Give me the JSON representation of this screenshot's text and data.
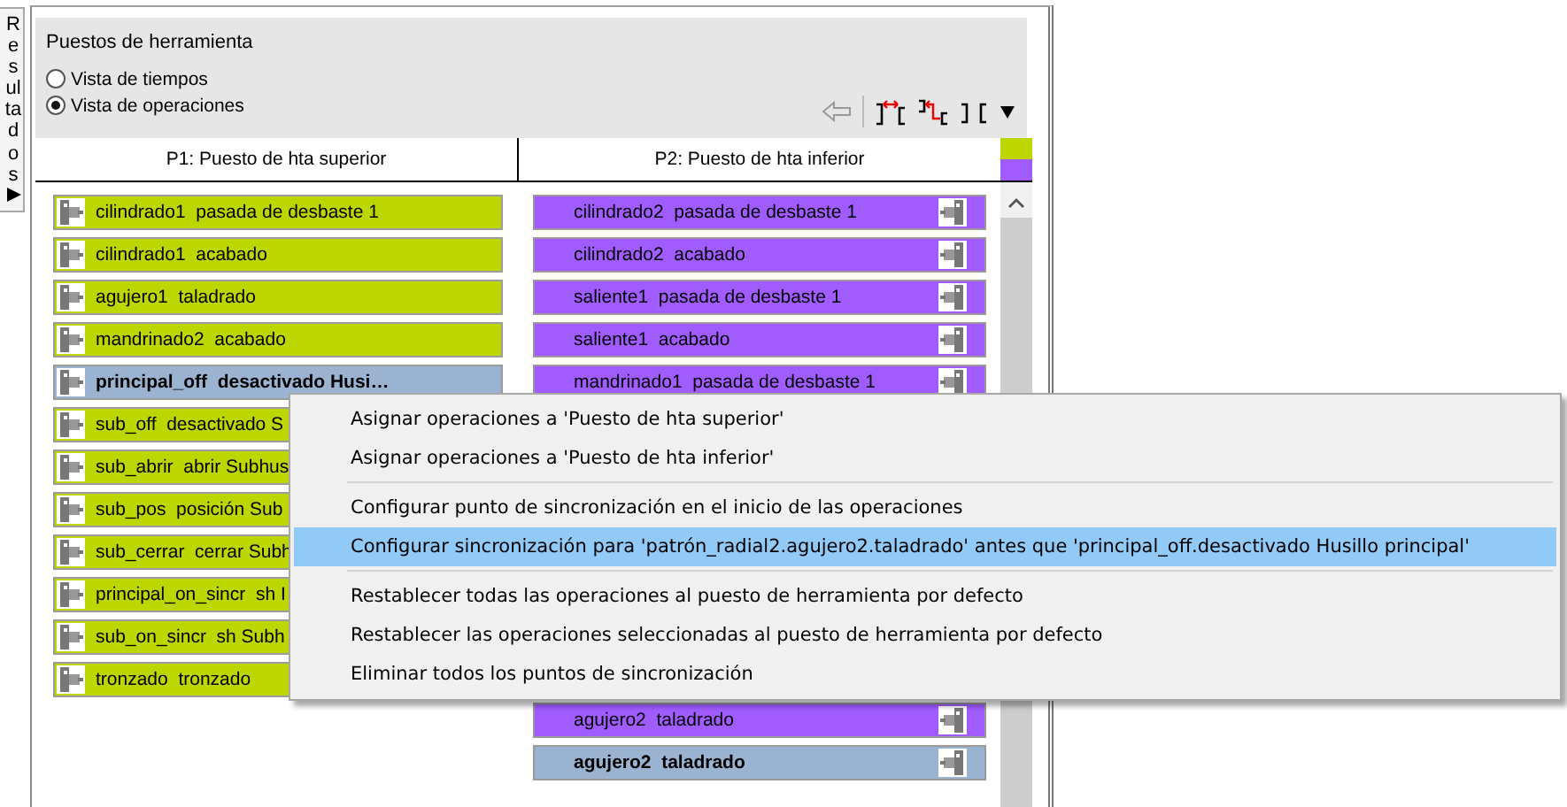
{
  "side_tab": {
    "label": "Resultados"
  },
  "panel": {
    "title": "Puestos de herramienta",
    "view_options": [
      {
        "label": "Vista de tiempos",
        "selected": false
      },
      {
        "label": "Vista de operaciones",
        "selected": true
      }
    ]
  },
  "columns": [
    {
      "header": "P1: Puesto de hta superior",
      "color": "#bdd600",
      "rows_above_menu": [
        {
          "text": "cilindrado1  pasada de desbaste 1",
          "selected": false
        },
        {
          "text": "cilindrado1  acabado",
          "selected": false
        },
        {
          "text": "agujero1  taladrado",
          "selected": false
        },
        {
          "text": "mandrinado2  acabado",
          "selected": false
        },
        {
          "text": "principal_off  desactivado Husi…",
          "selected": true
        },
        {
          "text": "sub_off  desactivado S",
          "selected": false
        },
        {
          "text": "sub_abrir  abrir Subhus",
          "selected": false
        },
        {
          "text": "sub_pos  posición Sub",
          "selected": false
        },
        {
          "text": "sub_cerrar  cerrar Subh",
          "selected": false
        },
        {
          "text": "principal_on_sincr  sh I",
          "selected": false
        },
        {
          "text": "sub_on_sincr  sh Subh",
          "selected": false
        },
        {
          "text": "tronzado  tronzado",
          "selected": false
        }
      ]
    },
    {
      "header": "P2: Puesto de hta inferior",
      "color": "#a05cff",
      "rows_above_menu": [
        {
          "text": "cilindrado2  pasada de desbaste 1",
          "selected": false
        },
        {
          "text": "cilindrado2  acabado",
          "selected": false
        },
        {
          "text": "saliente1  pasada de desbaste 1",
          "selected": false
        },
        {
          "text": "saliente1  acabado",
          "selected": false
        },
        {
          "text": "mandrinado1  pasada de desbaste 1",
          "selected": false
        }
      ],
      "rows_below_menu": [
        {
          "text": "agujero2  taladrado",
          "selected": false
        },
        {
          "text": "agujero2  taladrado",
          "selected": true
        }
      ]
    }
  ],
  "context_menu": [
    {
      "kind": "item",
      "label": "Asignar operaciones a 'Puesto de hta superior'",
      "selected": false
    },
    {
      "kind": "item",
      "label": "Asignar operaciones a 'Puesto de hta inferior'",
      "selected": false
    },
    {
      "kind": "separator"
    },
    {
      "kind": "item",
      "label": "Configurar punto de sincronización en el inicio de las operaciones",
      "selected": false
    },
    {
      "kind": "item",
      "label": "Configurar sincronización para 'patrón_radial2.agujero2.taladrado' antes que 'principal_off.desactivado Husillo principal'",
      "selected": true
    },
    {
      "kind": "separator"
    },
    {
      "kind": "item",
      "label": "Restablecer todas las operaciones al puesto de herramienta por defecto",
      "selected": false
    },
    {
      "kind": "item",
      "label": "Restablecer las operaciones seleccionadas al puesto de herramienta por defecto",
      "selected": false
    },
    {
      "kind": "item",
      "label": "Eliminar todos los puntos de sincronización",
      "selected": false
    }
  ]
}
